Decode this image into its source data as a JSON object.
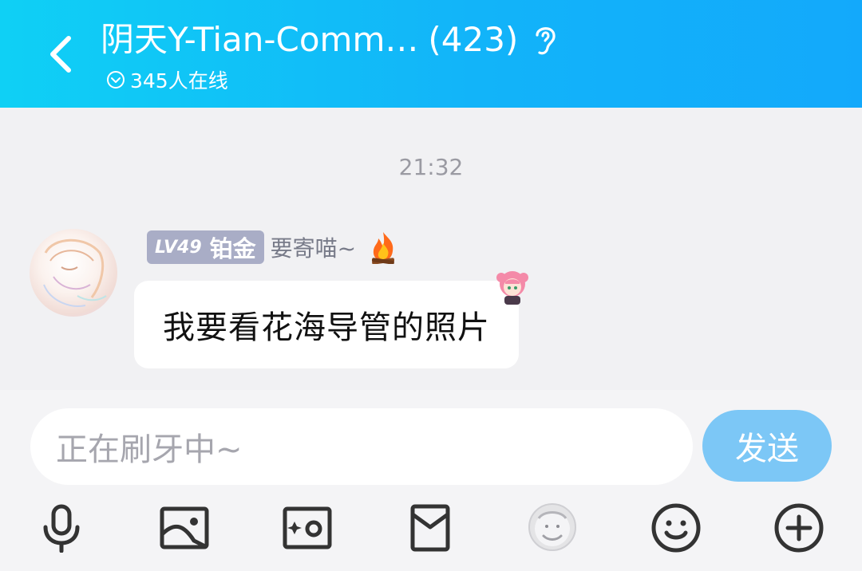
{
  "header": {
    "title": "阴天Y-Tian-Comm…",
    "member_count": "(423)",
    "online": "345人在线",
    "icons": {
      "back": "chevron-left-icon",
      "listen": "ear-icon",
      "online": "chevron-down-circle-icon"
    }
  },
  "chat": {
    "timestamp": "21:32",
    "messages": [
      {
        "level": "LV49",
        "rank": "铂金",
        "nickname": "要寄喵~",
        "text": "我要看花海导管的照片"
      }
    ]
  },
  "input": {
    "placeholder": "正在刷牙中~",
    "send_label": "发送"
  },
  "toolbar": {
    "icons": [
      "microphone-icon",
      "image-icon",
      "camera-icon",
      "red-packet-icon",
      "sticker-icon",
      "emoji-icon",
      "plus-icon"
    ]
  },
  "colors": {
    "header_start": "#0fd0f5",
    "header_end": "#13a9fb",
    "send_button": "#7cc7f6",
    "level_badge": "#a9adc6",
    "background": "#f1f1f3"
  }
}
